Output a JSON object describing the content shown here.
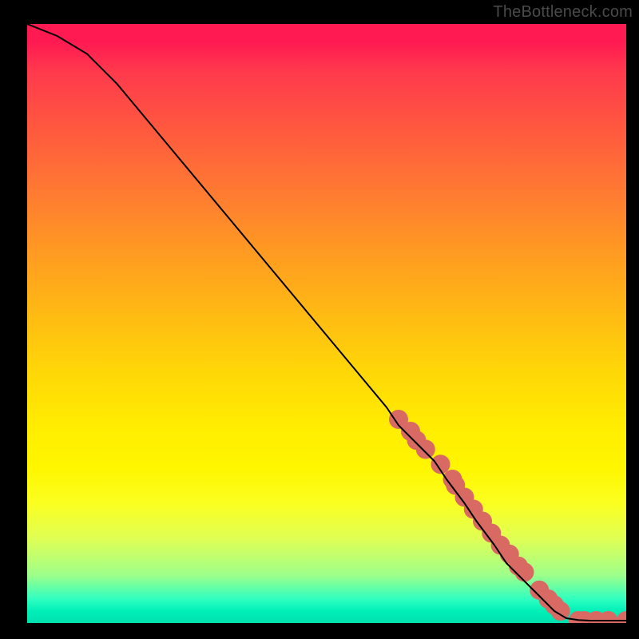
{
  "domain": "Chart",
  "watermark_text": "TheBottleneck.com",
  "chart_data": {
    "type": "line",
    "title": "",
    "xlabel": "",
    "ylabel": "",
    "xlim": [
      0,
      100
    ],
    "ylim": [
      0,
      100
    ],
    "curve": {
      "name": "main-curve",
      "x": [
        0,
        5,
        10,
        15,
        20,
        25,
        30,
        35,
        40,
        45,
        50,
        55,
        60,
        62,
        65,
        68,
        70,
        73,
        75,
        78,
        80,
        83,
        85,
        88,
        90,
        92,
        94,
        95.5,
        97,
        100
      ],
      "y": [
        100,
        98,
        95,
        90,
        84,
        78,
        72,
        66,
        60,
        54,
        48,
        42,
        36,
        33,
        30,
        27,
        24,
        20,
        17,
        13,
        10,
        7,
        5,
        2,
        0.8,
        0.5,
        0.4,
        0.4,
        0.4,
        0.4
      ]
    },
    "markers": {
      "name": "dots",
      "color": "#d86a63",
      "radius": 12,
      "x": [
        62,
        64,
        65,
        66.5,
        69,
        71,
        71.5,
        73,
        74.5,
        76,
        77.5,
        79,
        80.5,
        82,
        83,
        85.5,
        87,
        88,
        89,
        92,
        93,
        95,
        97,
        100
      ],
      "y": [
        34,
        32,
        30.5,
        29,
        26.5,
        24,
        23,
        21,
        19,
        17,
        15,
        13,
        11.5,
        9.5,
        8.5,
        5.5,
        4,
        3,
        2,
        0.4,
        0.4,
        0.4,
        0.4,
        0.4
      ]
    }
  }
}
